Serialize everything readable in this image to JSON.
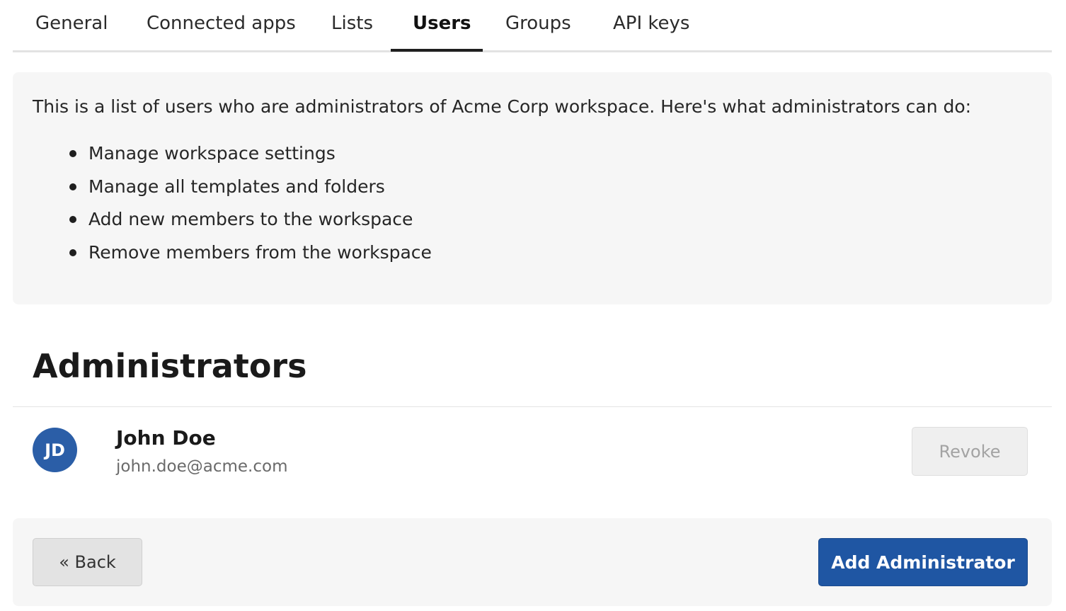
{
  "tabs": [
    {
      "label": "General"
    },
    {
      "label": "Connected apps"
    },
    {
      "label": "Lists"
    },
    {
      "label": "Users",
      "active": true
    },
    {
      "label": "Groups"
    },
    {
      "label": "API keys"
    }
  ],
  "info": {
    "intro": "This is a list of users who are administrators of Acme Corp workspace. Here's what administrators can do:",
    "permissions": [
      "Manage workspace settings",
      "Manage all templates and folders",
      "Add new members to the workspace",
      "Remove members from the workspace"
    ]
  },
  "section": {
    "title": "Administrators"
  },
  "admins": [
    {
      "initials": "JD",
      "name": "John Doe",
      "email": "john.doe@acme.com",
      "revoke_label": "Revoke"
    }
  ],
  "footer": {
    "back_label": "« Back",
    "add_label": "Add Administrator"
  },
  "colors": {
    "accent": "#1f56a3",
    "avatar": "#2b5ea7",
    "panel_bg": "#f6f6f6"
  }
}
